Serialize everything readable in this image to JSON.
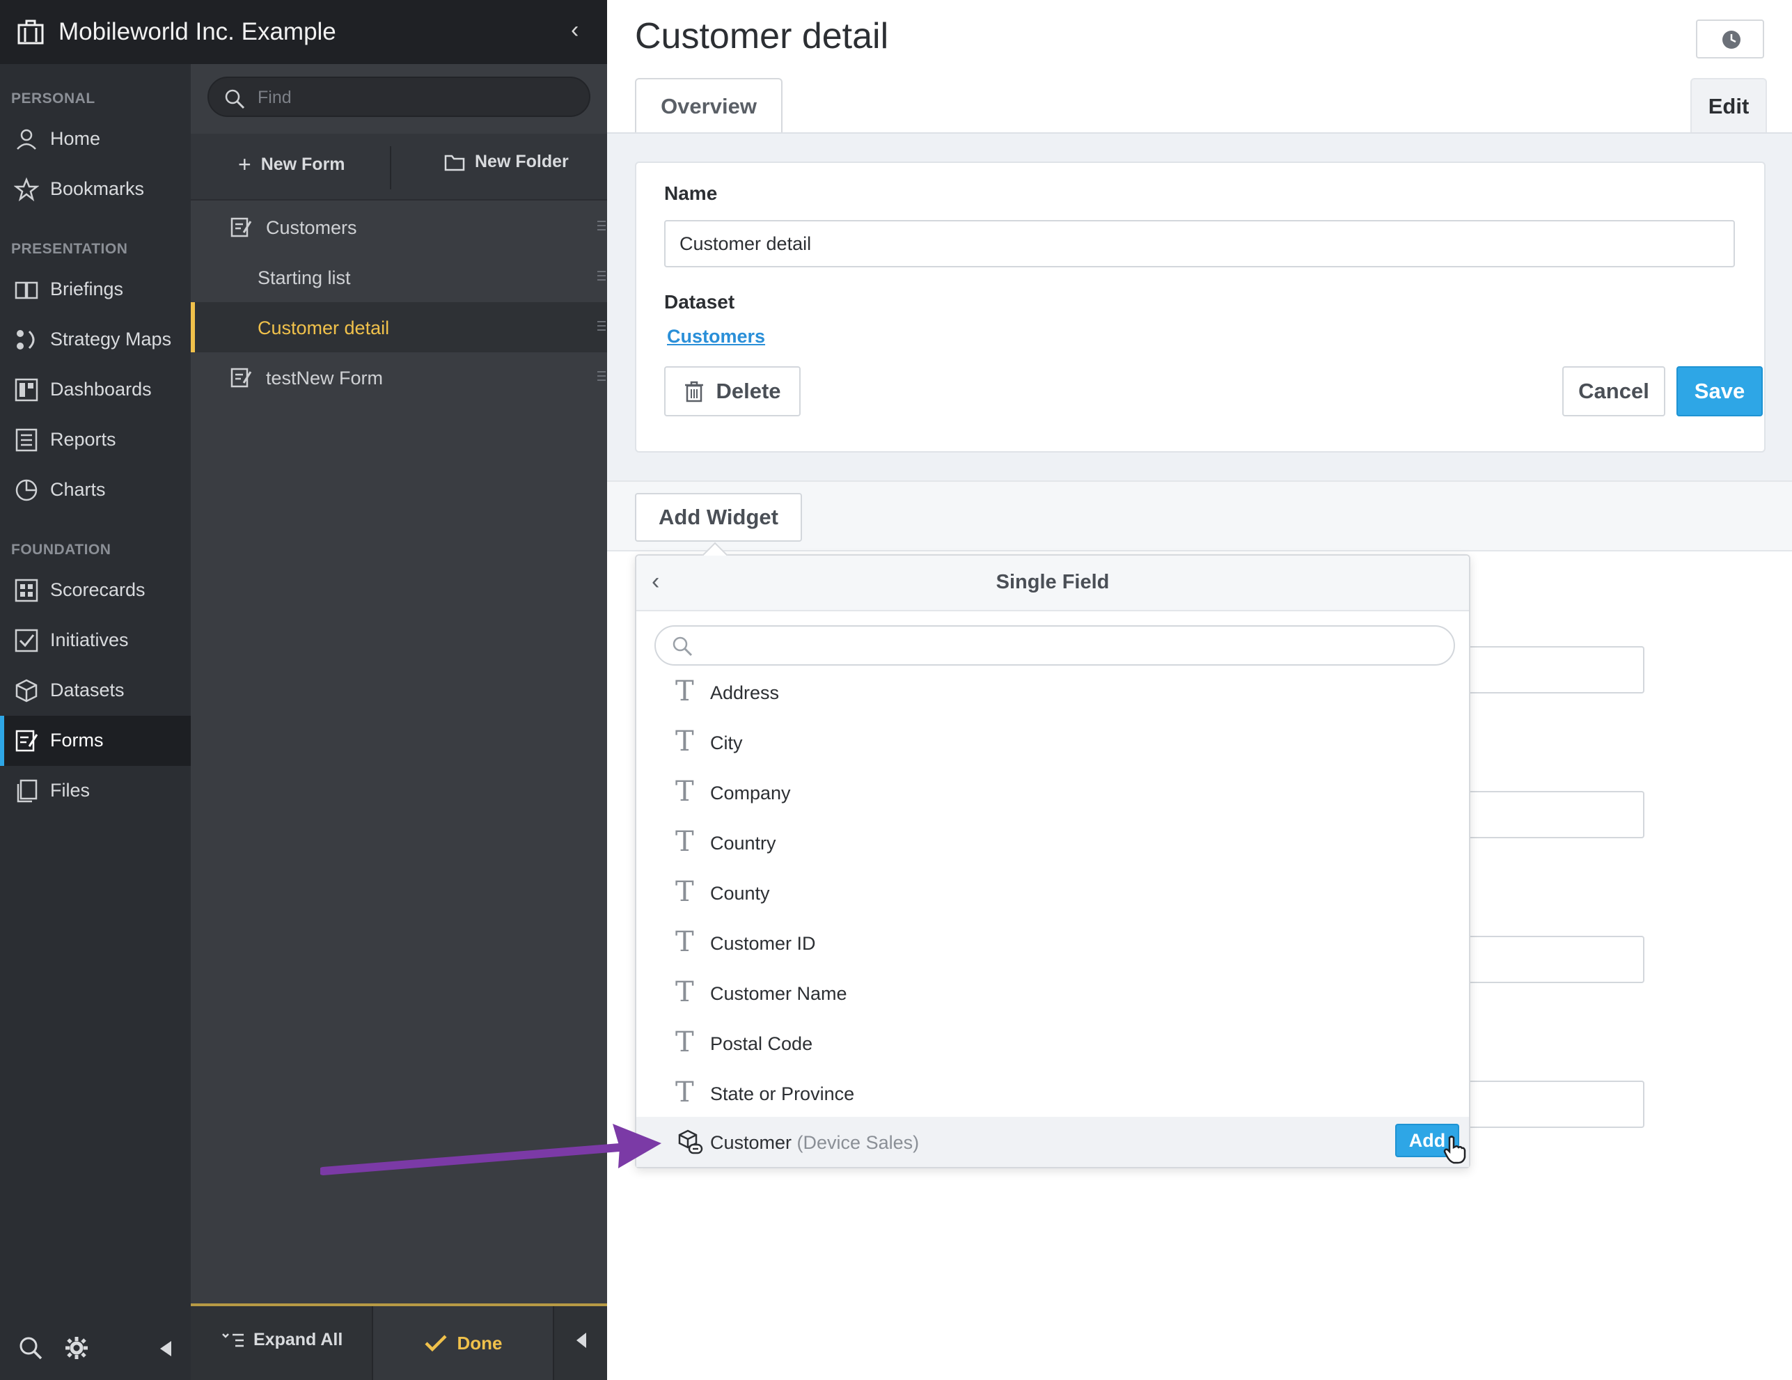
{
  "org": {
    "name": "Mobileworld Inc. Example"
  },
  "nav": {
    "sections": [
      {
        "title": "PERSONAL"
      },
      {
        "title": "PRESENTATION"
      },
      {
        "title": "FOUNDATION"
      }
    ],
    "items": [
      {
        "label": "Home",
        "icon": "person-icon"
      },
      {
        "label": "Bookmarks",
        "icon": "star-icon"
      },
      {
        "label": "Briefings",
        "icon": "book-icon"
      },
      {
        "label": "Strategy Maps",
        "icon": "strategy-map-icon"
      },
      {
        "label": "Dashboards",
        "icon": "dashboard-icon"
      },
      {
        "label": "Reports",
        "icon": "report-icon"
      },
      {
        "label": "Charts",
        "icon": "pie-chart-icon"
      },
      {
        "label": "Scorecards",
        "icon": "scorecard-icon"
      },
      {
        "label": "Initiatives",
        "icon": "checkbox-icon"
      },
      {
        "label": "Datasets",
        "icon": "cube-icon"
      },
      {
        "label": "Forms",
        "icon": "form-icon",
        "active": true
      },
      {
        "label": "Files",
        "icon": "files-icon"
      }
    ]
  },
  "panel": {
    "search_placeholder": "Find",
    "new_form_label": "New Form",
    "new_folder_label": "New Folder",
    "tree": [
      {
        "label": "Customers",
        "type": "folder"
      },
      {
        "label": "Starting list",
        "type": "form"
      },
      {
        "label": "Customer detail",
        "type": "form",
        "active": true
      },
      {
        "label": "testNew Form",
        "type": "folder"
      }
    ],
    "expand_all_label": "Expand All",
    "done_label": "Done"
  },
  "main": {
    "title": "Customer detail",
    "tabs": [
      {
        "label": "Overview"
      },
      {
        "label": "Edit",
        "active": true
      }
    ],
    "name_label": "Name",
    "name_value": "Customer detail",
    "dataset_label": "Dataset",
    "dataset_link": "Customers",
    "delete_label": "Delete",
    "cancel_label": "Cancel",
    "save_label": "Save",
    "add_widget_label": "Add Widget"
  },
  "popover": {
    "title": "Single Field",
    "search_value": "",
    "fields": [
      {
        "label": "Address",
        "icon": "text-type-icon"
      },
      {
        "label": "City",
        "icon": "text-type-icon"
      },
      {
        "label": "Company",
        "icon": "text-type-icon"
      },
      {
        "label": "Country",
        "icon": "text-type-icon"
      },
      {
        "label": "County",
        "icon": "text-type-icon"
      },
      {
        "label": "Customer ID",
        "icon": "text-type-icon"
      },
      {
        "label": "Customer Name",
        "icon": "text-type-icon"
      },
      {
        "label": "Postal Code",
        "icon": "text-type-icon"
      },
      {
        "label": "State or Province",
        "icon": "text-type-icon"
      }
    ],
    "related": {
      "label": "Customer",
      "sub": "(Device Sales)",
      "icon": "relationship-icon"
    },
    "add_label": "Add",
    "t_glyph": "T"
  },
  "colors": {
    "accent": "#2ea6e6",
    "active_folder": "#f0c14b",
    "nav_bg": "#2b2e33",
    "annotation_arrow": "#7b3aa6"
  }
}
